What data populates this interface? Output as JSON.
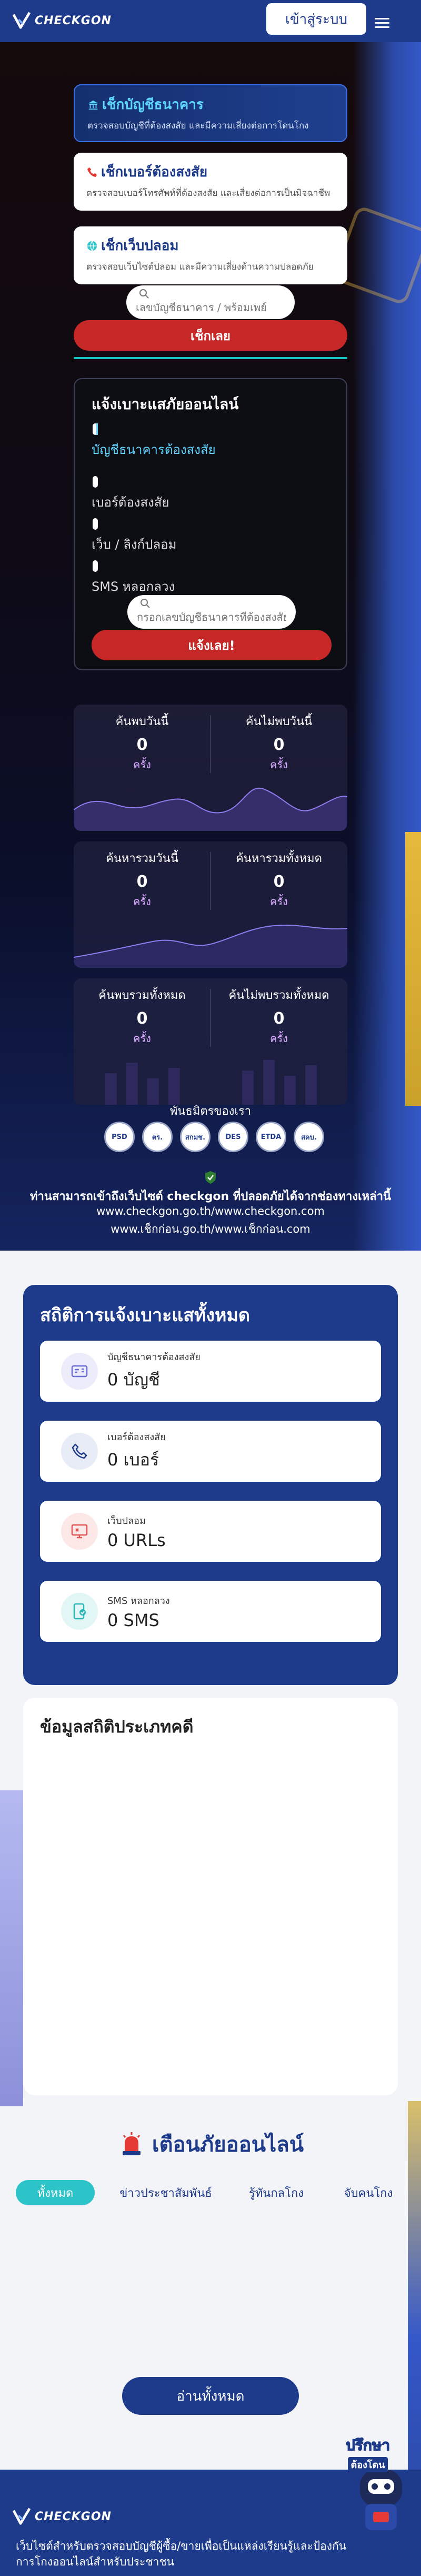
{
  "header": {
    "logo_text": "CHECKGON",
    "login_label": "เข้าสู่ระบบ"
  },
  "search": {
    "tabs": [
      {
        "title": "เช็กบัญชีธนาคาร",
        "desc": "ตรวจสอบบัญชีที่ต้องสงสัย และมีความเสี่ยงต่อการโดนโกง"
      },
      {
        "title": "เช็กเบอร์ต้องสงสัย",
        "desc": "ตรวจสอบเบอร์โทรศัพท์ที่ต้องสงสัย และเสี่ยงต่อการเป็นมิจฉาชีพ"
      },
      {
        "title": "เช็กเว็บปลอม",
        "desc": "ตรวจสอบเว็บไซต์ปลอม และมีความเสี่ยงด้านความปลอดภัย"
      }
    ],
    "placeholder": "เลขบัญชีธนาคาร / พร้อมเพย์",
    "button_label": "เช็กเลย"
  },
  "report": {
    "title": "แจ้งเบาะแสภัยออนไลน์",
    "options": [
      "บัญชีธนาคารต้องสงสัย",
      "เบอร์ต้องสงสัย",
      "เว็บ / ลิงก์ปลอม",
      "SMS หลอกลวง"
    ],
    "placeholder": "กรอกเลขบัญชีธนาคารที่ต้องสงสัย",
    "button_label": "แจ้งเลย!"
  },
  "daily_stats": [
    {
      "left_label": "ค้นพบวันนี้",
      "left_value": "0",
      "left_unit": "ครั้ง",
      "right_label": "ค้นไม่พบวันนี้",
      "right_value": "0",
      "right_unit": "ครั้ง"
    },
    {
      "left_label": "ค้นหารวมวันนี้",
      "left_value": "0",
      "left_unit": "ครั้ง",
      "right_label": "ค้นหารวมทั้งหมด",
      "right_value": "0",
      "right_unit": "ครั้ง"
    },
    {
      "left_label": "ค้นพบรวมทั้งหมด",
      "left_value": "0",
      "left_unit": "ครั้ง",
      "right_label": "ค้นไม่พบรวมทั้งหมด",
      "right_value": "0",
      "right_unit": "ครั้ง"
    }
  ],
  "partners": {
    "title": "พันธมิตรของเรา",
    "logos": [
      "PSD",
      "ตร.",
      "สกมช.",
      "DES",
      "ETDA",
      "สคบ."
    ]
  },
  "safe_notice": {
    "text": "ท่านสามารถเข้าถึงเว็บไซต์ checkgon ที่ปลอดภัยได้จากช่องทางเหล่านี้",
    "urls": [
      "www.checkgon.go.th/www.checkgon.com",
      "www.เช็กก่อน.go.th/www.เช็กก่อน.com"
    ]
  },
  "report_stats": {
    "title": "สถิติการแจ้งเบาะแสทั้งหมด",
    "items": [
      {
        "label": "บัญชีธนาคารต้องสงสัย",
        "value": "0 บัญชี",
        "icon": "bank-card-icon",
        "color": "#6b6fd6"
      },
      {
        "label": "เบอร์ต้องสงสัย",
        "value": "0 เบอร์",
        "icon": "phone-icon",
        "color": "#1e3a8a"
      },
      {
        "label": "เว็บปลอม",
        "value": "0 URLs",
        "icon": "monitor-icon",
        "color": "#e05555"
      },
      {
        "label": "SMS หลอกลวง",
        "value": "0 SMS",
        "icon": "sms-icon",
        "color": "#2cb8b8"
      }
    ]
  },
  "category_stats": {
    "title": "ข้อมูลสถิติประเภทคดี"
  },
  "alerts": {
    "title": "เตือนภัยออนไลน์",
    "tabs": [
      "ทั้งหมด",
      "ข่าวประชาสัมพันธ์",
      "รู้ทันกลโกง",
      "จับคนโกง"
    ],
    "read_all_label": "อ่านทั้งหมด"
  },
  "mascot": {
    "line1": "ปรึกษา",
    "line2": "ต้องโดน"
  },
  "footer": {
    "logo_text": "CHECKGON",
    "desc": "เว็บไซต์สำหรับตรวจสอบบัญชีผู้ซื้อ/ขายเพื่อเป็นแหล่งเรียนรู้และป้องกันการโกงออนไลน์สำหรับประชาชน"
  },
  "colors": {
    "brand": "#1e3a8a",
    "accent_red": "#c62828",
    "accent_teal": "#2cc4c8"
  }
}
